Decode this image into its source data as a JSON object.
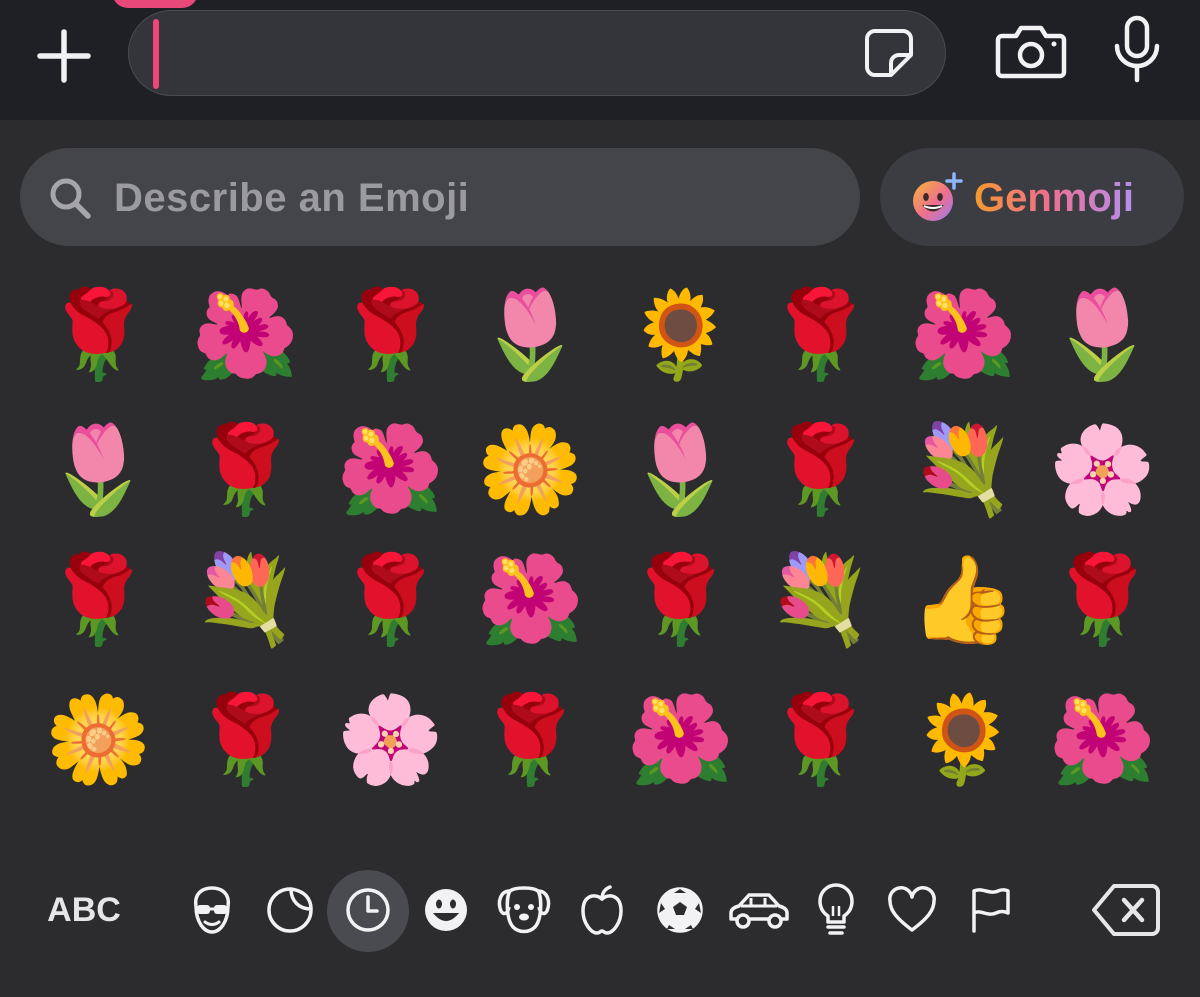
{
  "compose": {
    "field_value": "",
    "icons": [
      "plus-icon",
      "sticker-icon",
      "camera-icon",
      "microphone-icon"
    ]
  },
  "search": {
    "placeholder": "Describe an Emoji",
    "genmoji_label": "Genmoji"
  },
  "emoji_grid": [
    [
      "🌹",
      "🌺",
      "🌹",
      "🌷",
      "🌻",
      "🌹",
      "🌺",
      "🌷"
    ],
    [
      "🌷",
      "🌹",
      "🌺",
      "🌼",
      "🌷",
      "🌹",
      "💐",
      "🌸"
    ],
    [
      "🌹",
      "💐",
      "🌹",
      "🌺",
      "🌹",
      "💐",
      "👍",
      "🌹"
    ],
    [
      "🌼",
      "🌹",
      "🌸",
      "🌹",
      "🌺",
      "🌹",
      "🌻",
      "🌺"
    ]
  ],
  "keyboard": {
    "abc_label": "ABC",
    "categories": [
      {
        "name": "memoji-icon",
        "selected": false
      },
      {
        "name": "stickers-icon",
        "selected": false
      },
      {
        "name": "recents-clock-icon",
        "selected": true
      },
      {
        "name": "smileys-icon",
        "selected": false
      },
      {
        "name": "animals-dog-icon",
        "selected": false
      },
      {
        "name": "food-apple-icon",
        "selected": false
      },
      {
        "name": "activity-soccer-icon",
        "selected": false
      },
      {
        "name": "travel-car-icon",
        "selected": false
      },
      {
        "name": "objects-lightbulb-icon",
        "selected": false
      },
      {
        "name": "symbols-heart-icon",
        "selected": false
      },
      {
        "name": "flags-icon",
        "selected": false
      }
    ],
    "delete_icon": "delete-backspace-icon"
  },
  "colors": {
    "background": "#2c2c2e",
    "topbar": "#1f2025",
    "cursor": "#f0457a",
    "genmoji_gradient": [
      "#f59a2e",
      "#ef6f8c",
      "#b58ef0"
    ]
  }
}
